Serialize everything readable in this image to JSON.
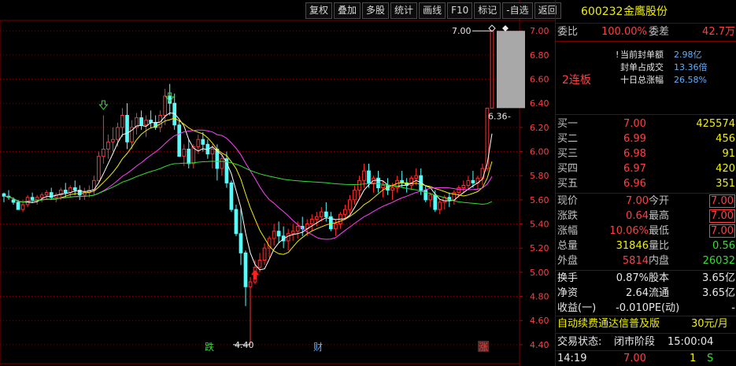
{
  "toolbar": {
    "buttons": [
      "复权",
      "叠加",
      "多股",
      "统计",
      "画线",
      "F10",
      "标记",
      "-自选",
      "返回"
    ]
  },
  "stock": {
    "code": "600232",
    "name": "金鹰股份"
  },
  "order_summary": {
    "wei_bi_label": "委比",
    "wei_bi_value": "100.00%",
    "wei_cha_label": "委差",
    "wei_cha_value": "42.7万",
    "board_label": "2连板",
    "lines": [
      {
        "label": "当前封单额",
        "value": "2.98亿",
        "prefix": "!"
      },
      {
        "label": "封单占成交",
        "value": "13.36倍",
        "prefix": ""
      },
      {
        "label": "十日总涨幅",
        "value": "26.58%",
        "prefix": ""
      }
    ]
  },
  "bids": [
    {
      "label": "买一",
      "price": "7.00",
      "volume": "425574"
    },
    {
      "label": "买二",
      "price": "6.99",
      "volume": "456"
    },
    {
      "label": "买三",
      "price": "6.98",
      "volume": "91"
    },
    {
      "label": "买四",
      "price": "6.97",
      "volume": "420"
    },
    {
      "label": "买五",
      "price": "6.96",
      "volume": "351"
    }
  ],
  "quote": [
    {
      "l1": "现价",
      "v1": "7.00",
      "c1": "red",
      "l2": "今开",
      "v2": "7.00",
      "c2": "red",
      "b2": true
    },
    {
      "l1": "涨跌",
      "v1": "0.64",
      "c1": "red",
      "l2": "最高",
      "v2": "7.00",
      "c2": "red",
      "b2": true
    },
    {
      "l1": "涨幅",
      "v1": "10.06%",
      "c1": "red",
      "l2": "最低",
      "v2": "7.00",
      "c2": "red",
      "b2": true
    },
    {
      "l1": "总量",
      "v1": "31846",
      "c1": "yellow",
      "l2": "量比",
      "v2": "0.56",
      "c2": "green",
      "b2": false
    },
    {
      "l1": "外盘",
      "v1": "5814",
      "c1": "red",
      "l2": "内盘",
      "v2": "26032",
      "c2": "green",
      "b2": false
    }
  ],
  "fundamentals": [
    {
      "l1": "换手",
      "v1": "0.87%",
      "l2": "股本",
      "v2": "3.65亿"
    },
    {
      "l1": "净资",
      "v1": "2.64",
      "l2": "流通",
      "v2": "3.65亿"
    },
    {
      "l1": "收益(一)",
      "v1": "-0.010",
      "l2": "PE(动)",
      "v2": "-"
    }
  ],
  "promo": {
    "text": "自动续费通达信普及版",
    "price": "30元/月"
  },
  "trade_status": {
    "label": "交易状态:",
    "value": "闭市阶段",
    "time": "15:00:04"
  },
  "last_tick": {
    "time": "14:19",
    "price": "7.00",
    "qty": "1",
    "side": "S"
  },
  "axis": {
    "ticks": [
      "7.00",
      "6.80",
      "6.60",
      "6.40",
      "6.20",
      "6.00",
      "5.80",
      "5.60",
      "5.40",
      "5.20",
      "5.00",
      "4.80",
      "4.60",
      "4.40"
    ],
    "max_label": "7.00",
    "min_label": "4.40",
    "prev_close_label": "6.36"
  },
  "markers": {
    "die": "跌",
    "cai": "财",
    "zhang": "涨"
  },
  "chart_data": {
    "type": "candlestick",
    "y_range": [
      4.36,
      7.06
    ],
    "candles": [
      [
        5.65,
        5.66,
        5.58,
        5.63
      ],
      [
        5.63,
        5.68,
        5.6,
        5.62
      ],
      [
        5.6,
        5.62,
        5.56,
        5.58
      ],
      [
        5.58,
        5.6,
        5.52,
        5.52
      ],
      [
        5.52,
        5.6,
        5.5,
        5.56
      ],
      [
        5.56,
        5.64,
        5.54,
        5.62
      ],
      [
        5.62,
        5.66,
        5.58,
        5.6
      ],
      [
        5.6,
        5.64,
        5.56,
        5.62
      ],
      [
        5.62,
        5.66,
        5.58,
        5.64
      ],
      [
        5.64,
        5.68,
        5.6,
        5.66
      ],
      [
        5.66,
        5.7,
        5.6,
        5.62
      ],
      [
        5.62,
        5.66,
        5.58,
        5.64
      ],
      [
        5.64,
        5.7,
        5.6,
        5.68
      ],
      [
        5.68,
        5.74,
        5.62,
        5.66
      ],
      [
        5.66,
        5.72,
        5.62,
        5.7
      ],
      [
        5.7,
        5.76,
        5.64,
        5.68
      ],
      [
        5.68,
        5.72,
        5.6,
        5.64
      ],
      [
        5.64,
        5.7,
        5.6,
        5.66
      ],
      [
        5.66,
        5.72,
        5.62,
        5.68
      ],
      [
        5.68,
        5.8,
        5.64,
        5.76
      ],
      [
        5.76,
        6.0,
        5.74,
        5.96
      ],
      [
        5.96,
        6.3,
        5.9,
        6.02
      ],
      [
        6.02,
        6.14,
        5.94,
        6.08
      ],
      [
        6.08,
        6.2,
        6.0,
        6.1
      ],
      [
        6.1,
        6.24,
        6.04,
        6.2
      ],
      [
        6.2,
        6.36,
        6.12,
        6.3
      ],
      [
        6.3,
        6.4,
        6.02,
        6.08
      ],
      [
        6.08,
        6.26,
        6.02,
        6.2
      ],
      [
        6.2,
        6.32,
        6.14,
        6.28
      ],
      [
        6.28,
        6.34,
        6.18,
        6.22
      ],
      [
        6.22,
        6.3,
        6.12,
        6.26
      ],
      [
        6.26,
        6.34,
        6.2,
        6.24
      ],
      [
        6.24,
        6.3,
        6.18,
        6.2
      ],
      [
        6.2,
        6.34,
        6.16,
        6.3
      ],
      [
        6.3,
        6.52,
        6.22,
        6.46
      ],
      [
        6.46,
        6.56,
        6.3,
        6.4
      ],
      [
        6.4,
        6.48,
        6.18,
        6.22
      ],
      [
        6.22,
        6.26,
        5.96,
        5.96
      ],
      [
        5.96,
        6.06,
        5.88,
        6.02
      ],
      [
        6.02,
        6.1,
        5.86,
        5.9
      ],
      [
        5.9,
        6.06,
        5.86,
        6.04
      ],
      [
        6.04,
        6.14,
        5.98,
        6.1
      ],
      [
        6.1,
        6.16,
        6.0,
        6.06
      ],
      [
        6.06,
        6.1,
        5.94,
        5.98
      ],
      [
        5.98,
        6.06,
        5.86,
        6.02
      ],
      [
        6.02,
        6.06,
        5.76,
        5.86
      ],
      [
        5.86,
        5.98,
        5.8,
        5.94
      ],
      [
        5.94,
        6.0,
        5.7,
        5.74
      ],
      [
        5.74,
        5.76,
        5.5,
        5.52
      ],
      [
        5.52,
        5.56,
        5.3,
        5.32
      ],
      [
        5.32,
        5.54,
        5.06,
        5.16
      ],
      [
        5.16,
        5.18,
        4.72,
        4.88
      ],
      [
        4.88,
        4.96,
        4.4,
        4.92
      ],
      [
        4.92,
        5.1,
        4.9,
        5.04
      ],
      [
        5.04,
        5.16,
        5.0,
        5.1
      ],
      [
        5.1,
        5.24,
        5.06,
        5.2
      ],
      [
        5.2,
        5.3,
        5.12,
        5.28
      ],
      [
        5.28,
        5.4,
        5.22,
        5.34
      ],
      [
        5.34,
        5.42,
        5.24,
        5.3
      ],
      [
        5.3,
        5.38,
        5.2,
        5.26
      ],
      [
        5.26,
        5.36,
        5.18,
        5.32
      ],
      [
        5.32,
        5.4,
        5.26,
        5.34
      ],
      [
        5.34,
        5.42,
        5.28,
        5.38
      ],
      [
        5.38,
        5.46,
        5.3,
        5.36
      ],
      [
        5.36,
        5.44,
        5.3,
        5.4
      ],
      [
        5.4,
        5.48,
        5.34,
        5.44
      ],
      [
        5.44,
        5.5,
        5.38,
        5.46
      ],
      [
        5.46,
        5.54,
        5.42,
        5.5
      ],
      [
        5.5,
        5.58,
        5.42,
        5.46
      ],
      [
        5.46,
        5.5,
        5.34,
        5.36
      ],
      [
        5.36,
        5.44,
        5.3,
        5.4
      ],
      [
        5.4,
        5.5,
        5.36,
        5.48
      ],
      [
        5.48,
        5.56,
        5.44,
        5.52
      ],
      [
        5.52,
        5.64,
        5.48,
        5.6
      ],
      [
        5.6,
        5.72,
        5.56,
        5.68
      ],
      [
        5.68,
        5.8,
        5.62,
        5.76
      ],
      [
        5.76,
        5.9,
        5.7,
        5.84
      ],
      [
        5.84,
        5.9,
        5.7,
        5.74
      ],
      [
        5.74,
        5.8,
        5.66,
        5.78
      ],
      [
        5.78,
        5.84,
        5.66,
        5.7
      ],
      [
        5.7,
        5.76,
        5.62,
        5.72
      ],
      [
        5.72,
        5.78,
        5.64,
        5.68
      ],
      [
        5.68,
        5.74,
        5.6,
        5.7
      ],
      [
        5.7,
        5.8,
        5.66,
        5.76
      ],
      [
        5.76,
        5.84,
        5.7,
        5.74
      ],
      [
        5.74,
        5.78,
        5.66,
        5.72
      ],
      [
        5.72,
        5.8,
        5.68,
        5.78
      ],
      [
        5.78,
        5.86,
        5.72,
        5.8
      ],
      [
        5.8,
        5.86,
        5.64,
        5.68
      ],
      [
        5.68,
        5.72,
        5.58,
        5.6
      ],
      [
        5.6,
        5.66,
        5.54,
        5.64
      ],
      [
        5.64,
        5.68,
        5.5,
        5.52
      ],
      [
        5.52,
        5.6,
        5.48,
        5.58
      ],
      [
        5.58,
        5.64,
        5.52,
        5.62
      ],
      [
        5.62,
        5.66,
        5.54,
        5.6
      ],
      [
        5.6,
        5.68,
        5.56,
        5.66
      ],
      [
        5.66,
        5.72,
        5.62,
        5.7
      ],
      [
        5.7,
        5.76,
        5.66,
        5.72
      ],
      [
        5.72,
        5.8,
        5.68,
        5.76
      ],
      [
        5.76,
        5.84,
        5.7,
        5.74
      ],
      [
        5.74,
        5.8,
        5.68,
        5.78
      ],
      [
        5.78,
        5.9,
        5.72,
        5.86
      ],
      [
        5.86,
        6.36,
        5.84,
        6.36
      ],
      [
        6.36,
        7.0,
        6.36,
        7.0
      ]
    ]
  }
}
